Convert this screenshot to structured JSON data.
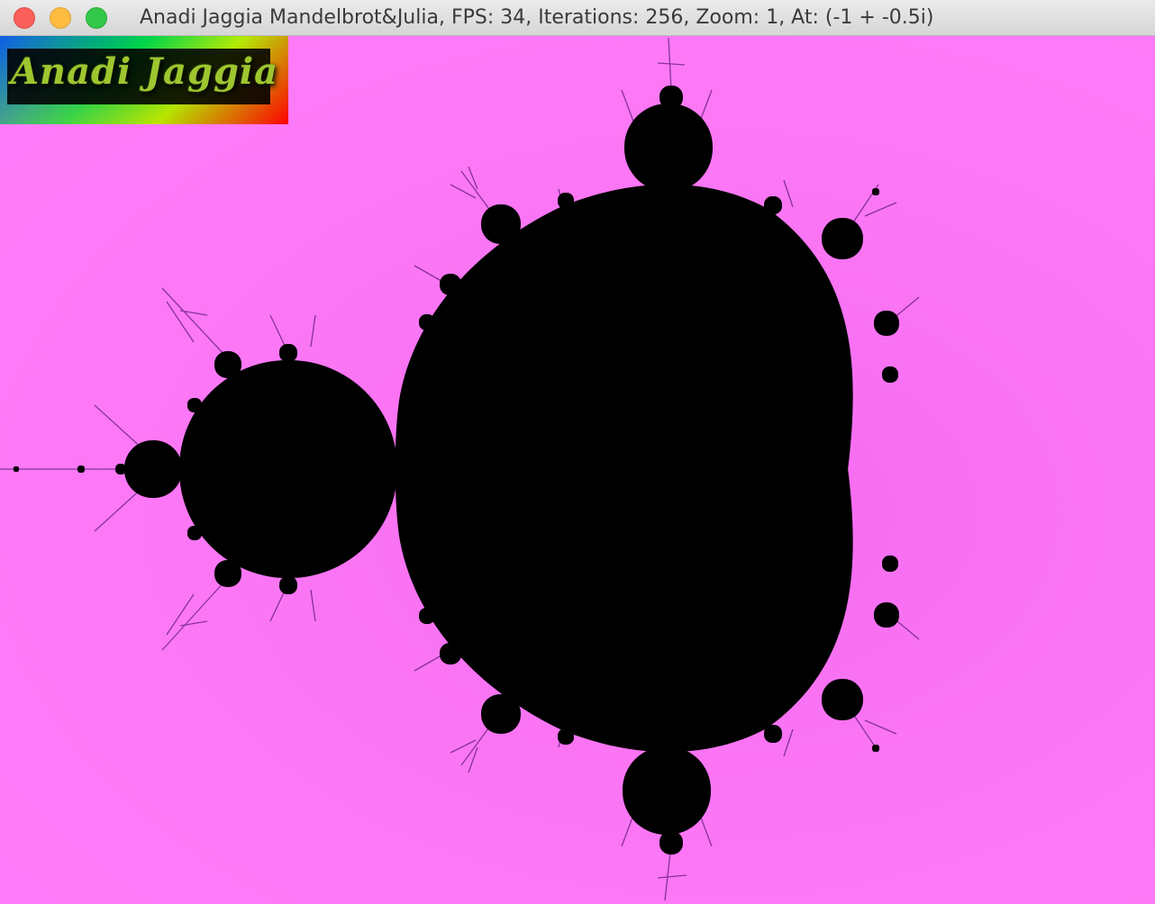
{
  "window": {
    "title": "Anadi Jaggia Mandelbrot&Julia, FPS: 34, Iterations: 256, Zoom: 1, At: (-1 + -0.5i)",
    "controls": [
      "close",
      "minimize",
      "zoom"
    ]
  },
  "logo": {
    "text": "Anadi Jaggia"
  },
  "fractal": {
    "type": "mandelbrot",
    "background_color": "#ff7cf8",
    "set_color": "#000000",
    "edge_color": "#7a2a90"
  }
}
